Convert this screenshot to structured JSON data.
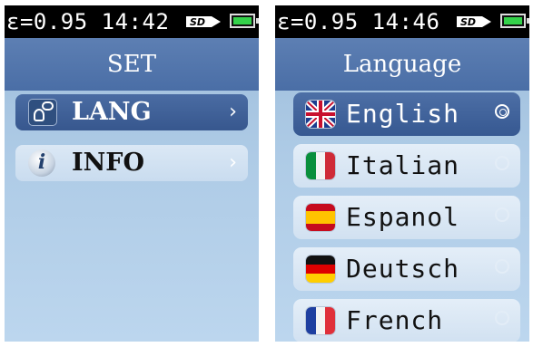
{
  "left_screen": {
    "status": {
      "text": "ε=0.95 14:42",
      "sd_label": "SD"
    },
    "title": "SET",
    "menu": [
      {
        "label": "LANG",
        "icon": "language-icon",
        "selected": true,
        "chevron": "›"
      },
      {
        "label": "INFO",
        "icon": "info-icon",
        "selected": false,
        "chevron": "›"
      }
    ]
  },
  "right_screen": {
    "status": {
      "text": "ε=0.95 14:46",
      "sd_label": "SD"
    },
    "title": "Language",
    "languages": [
      {
        "label": "English",
        "flag": "uk-flag-icon",
        "selected": true
      },
      {
        "label": "Italian",
        "flag": "italy-flag-icon",
        "selected": false
      },
      {
        "label": "Espanol",
        "flag": "spain-flag-icon",
        "selected": false
      },
      {
        "label": "Deutsch",
        "flag": "germany-flag-icon",
        "selected": false
      },
      {
        "label": "French",
        "flag": "france-flag-icon",
        "selected": false
      }
    ]
  },
  "colors": {
    "selected_bg": "#3f619a",
    "title_bg": "#4f73aa",
    "screen_bg": "#aecbe6",
    "battery": "#34d24a"
  }
}
